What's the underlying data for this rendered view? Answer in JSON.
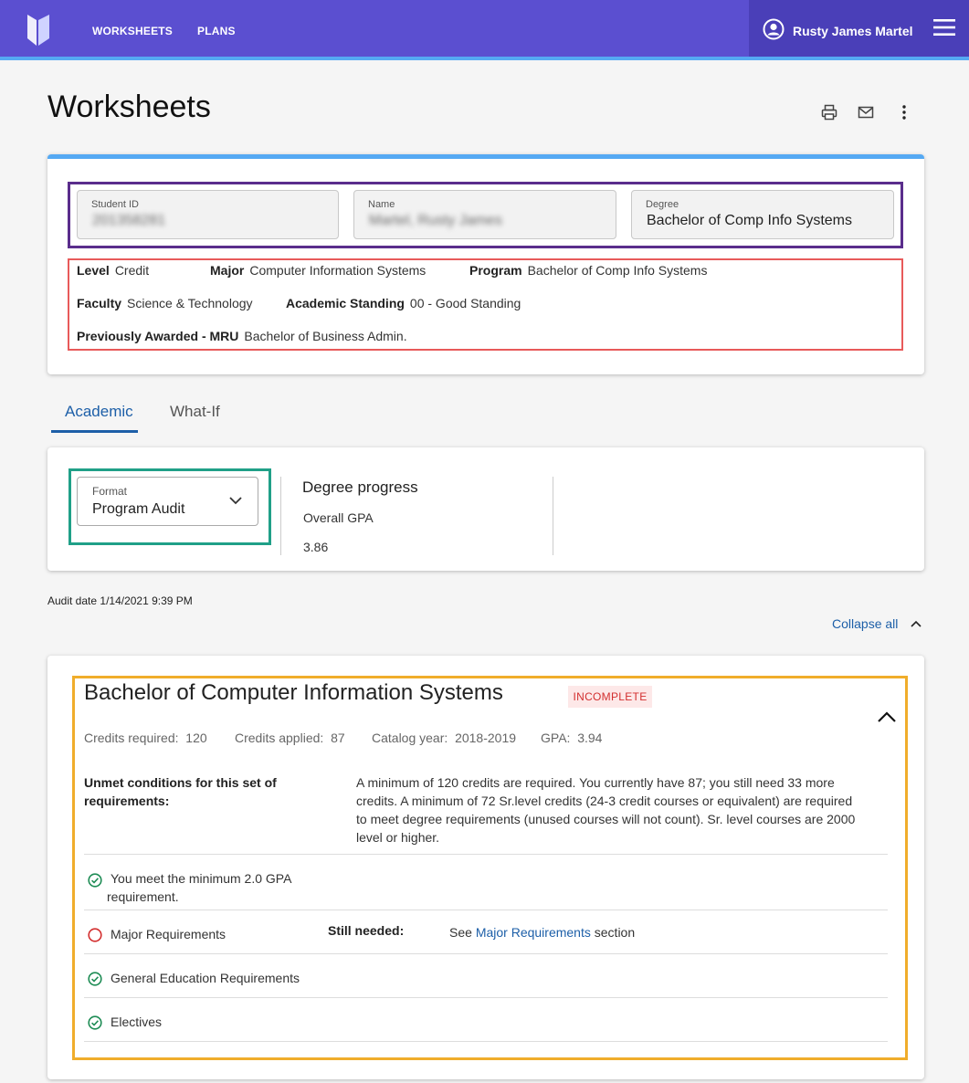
{
  "header": {
    "nav": [
      "WORKSHEETS",
      "PLANS"
    ],
    "user_name": "Rusty James Martel",
    "logo_icon": "shield-logo-icon",
    "user_icon": "account-circle-icon",
    "menu_icon": "hamburger-menu-icon"
  },
  "page": {
    "title": "Worksheets",
    "tools": [
      "print-icon",
      "email-icon",
      "more-vertical-icon"
    ]
  },
  "student": {
    "student_id_label": "Student ID",
    "student_id_value": "201358281",
    "name_label": "Name",
    "name_value": "Martel, Rusty James",
    "degree_label": "Degree",
    "degree_value": "Bachelor of Comp Info Systems",
    "level_label": "Level",
    "level_value": "Credit",
    "major_label": "Major",
    "major_value": "Computer Information Systems",
    "program_label": "Program",
    "program_value": "Bachelor of Comp Info Systems",
    "faculty_label": "Faculty",
    "faculty_value": "Science & Technology",
    "standing_label": "Academic Standing",
    "standing_value": "00 - Good Standing",
    "prev_label": "Previously Awarded - MRU",
    "prev_value": "Bachelor of Business Admin."
  },
  "tabs": [
    "Academic",
    "What-If"
  ],
  "format": {
    "label": "Format",
    "value": "Program Audit"
  },
  "progress": {
    "title": "Degree progress",
    "gpa_label": "Overall GPA",
    "gpa_value": "3.86"
  },
  "audit": {
    "date_label": "Audit date",
    "date_value": "1/14/2021 9:39 PM",
    "collapse_label": "Collapse all"
  },
  "block": {
    "title": "Bachelor of Computer Information Systems",
    "status": "INCOMPLETE",
    "credits_required_label": "Credits required:",
    "credits_required": "120",
    "credits_applied_label": "Credits applied:",
    "credits_applied": "87",
    "catalog_label": "Catalog year:",
    "catalog_year": "2018-2019",
    "gpa_label": "GPA:",
    "gpa": "3.94",
    "unmet_label_1": "Unmet conditions for this set of",
    "unmet_label_2": "requirements:",
    "unmet_lines": [
      "A minimum of 120 credits are required. You currently have 87; you still need 33 more",
      "credits. A minimum of 72 Sr.level credits (24-3 credit courses or equivalent) are required",
      "to meet degree requirements (unused courses will not count). Sr. level courses are 2000",
      "level or higher."
    ],
    "requirements": [
      {
        "lines": [
          "You meet the minimum 2.0 GPA",
          "requirement."
        ],
        "status": "complete"
      },
      {
        "lines": [
          "Major Requirements"
        ],
        "status": "incomplete",
        "still_needed_label": "Still needed:",
        "see_prefix": "See",
        "see_link": "Major Requirements",
        "see_suffix": "section"
      },
      {
        "lines": [
          "General Education Requirements"
        ],
        "status": "complete"
      },
      {
        "lines": [
          "Electives"
        ],
        "status": "complete"
      }
    ],
    "status_colors": {
      "complete": "#1e8c55",
      "incomplete": "#d32f2f"
    }
  }
}
